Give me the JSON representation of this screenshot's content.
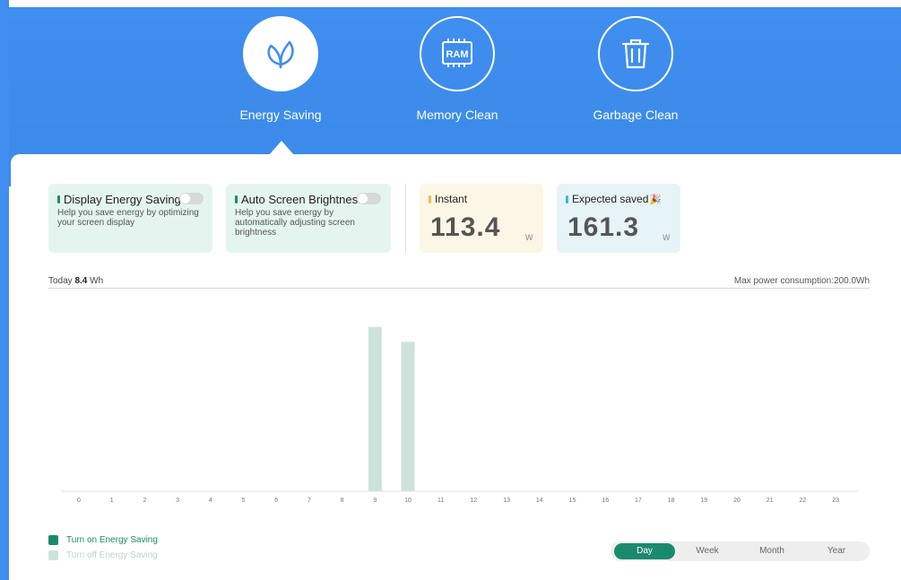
{
  "nav": [
    {
      "label": "Energy Saving",
      "icon": "leaf-icon",
      "active": true
    },
    {
      "label": "Memory Clean",
      "icon": "ram-chip-icon",
      "icon_text": "RAM",
      "active": false
    },
    {
      "label": "Garbage Clean",
      "icon": "trash-icon",
      "active": false
    }
  ],
  "features": [
    {
      "title": "Display Energy Saving",
      "desc": "Help you save energy by optimizing your screen display",
      "enabled": false
    },
    {
      "title": "Auto Screen Brightness",
      "desc": "Help you save energy by automatically adjusting screen brightness",
      "enabled": false
    }
  ],
  "stats": {
    "instant": {
      "title": "Instant",
      "value": "113.4",
      "unit": "W"
    },
    "expected": {
      "title": "Expected saved",
      "emoji": "🎉",
      "value": "161.3",
      "unit": "W"
    }
  },
  "summary": {
    "today_prefix": "Today",
    "today_value": "8.4",
    "today_unit": "Wh",
    "max_power": "Max power consumption:200.0Wh"
  },
  "chart_data": {
    "type": "bar",
    "categories": [
      "0",
      "1",
      "2",
      "3",
      "4",
      "5",
      "6",
      "7",
      "8",
      "9",
      "10",
      "11",
      "12",
      "13",
      "14",
      "15",
      "16",
      "17",
      "18",
      "19",
      "20",
      "21",
      "22",
      "23"
    ],
    "values": [
      0,
      0,
      0,
      0,
      0,
      0,
      0,
      0,
      0,
      4.4,
      4.0,
      0,
      0,
      0,
      0,
      0,
      0,
      0,
      0,
      0,
      0,
      0,
      0,
      0
    ],
    "ylim": [
      0,
      4.8
    ],
    "bar_color": "#cde3da",
    "grid": false
  },
  "legend": [
    {
      "label": "Turn on Energy Saving",
      "color": "#1a8a6d"
    },
    {
      "label": "Turn off Energy Saving",
      "color": "#cde3da"
    }
  ],
  "periods": {
    "options": [
      "Day",
      "Week",
      "Month",
      "Year"
    ],
    "selected": "Day"
  },
  "colors": {
    "header_blue": "#3f8ef0",
    "accent_green": "#1a8a6d",
    "feature_bg": "#e4f5ef",
    "instant_bg": "#fbf6e5",
    "expected_bg": "#e6f3f7"
  }
}
